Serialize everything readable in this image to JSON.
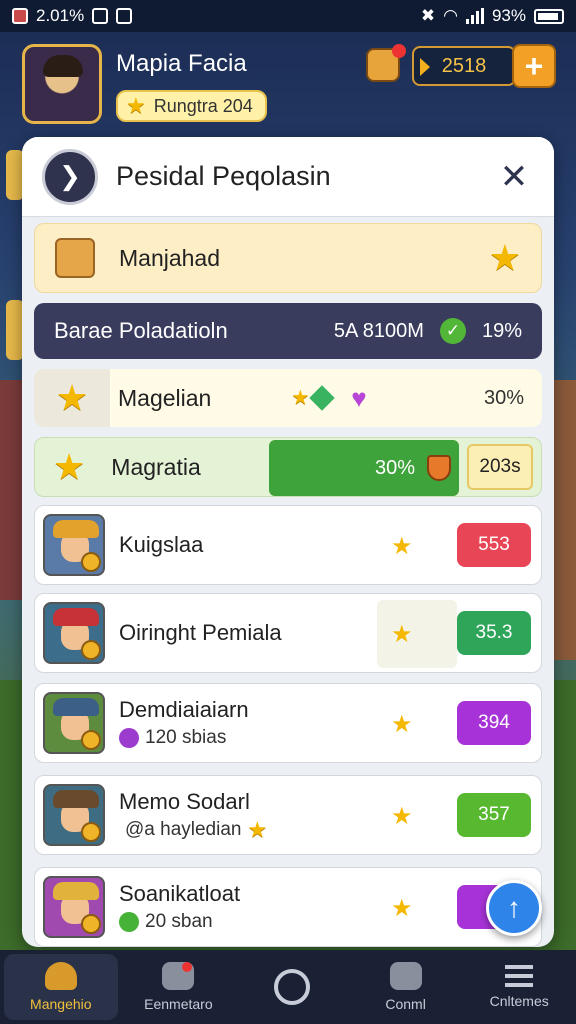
{
  "status_bar": {
    "time": "2.01%",
    "battery": "93%"
  },
  "header": {
    "player_name": "Mapia Facia",
    "rank_label": "Rungtra 204",
    "coins": "2518",
    "plus_label": "+"
  },
  "panel": {
    "title": "Pesidal Peqolasin",
    "logo_glyph": "❯",
    "close_label": "✕",
    "row1": {
      "label": "Manjahad",
      "icon": "chest-icon"
    },
    "row2": {
      "label": "Barae Poladatioln",
      "value": "5A 8100M",
      "percent": "19%"
    },
    "row3": {
      "label": "Magelian",
      "percent": "30%"
    },
    "row4": {
      "label": "Magratia",
      "bar_text": "30%",
      "progress": 0.3,
      "box_value": "203s"
    },
    "cards": [
      {
        "name": "Kuigslaa",
        "sub": "",
        "badge": "553",
        "badge_color": "#e84556",
        "hat_color": "#e3a22c",
        "bg": "#5a7ba8"
      },
      {
        "name": "Oiringht Pemiala",
        "sub": "",
        "badge": "35.3",
        "badge_color": "#2fa55a",
        "hat_color": "#c73236",
        "bg": "#3c6d8a"
      },
      {
        "name": "Demdiaiaiarn",
        "sub": "120 sbias",
        "sub_icon_color": "#9b3ccf",
        "badge": "394",
        "badge_color": "#a733d8",
        "hat_color": "#3b5f86",
        "bg": "#5d8c3f"
      },
      {
        "name": "Memo Sodarl",
        "sub": "@a hayledian",
        "sub_icon_color": "none",
        "badge": "357",
        "badge_color": "#58b930",
        "hat_color": "#6a4a2c",
        "bg": "#3e6c82"
      },
      {
        "name": "Soanikatloat",
        "sub": "20 sban",
        "sub_icon_color": "#46b338",
        "badge": "3",
        "badge_color": "#a733d8",
        "hat_color": "#e2b33a",
        "bg": "#a04ab0"
      }
    ]
  },
  "fab": {
    "label": "↑"
  },
  "nav": [
    {
      "label": "Mangehio",
      "active": true
    },
    {
      "label": "Eenmetaro",
      "active": false
    },
    {
      "label": "",
      "active": false
    },
    {
      "label": "Conml",
      "active": false
    },
    {
      "label": "Cnltemes",
      "active": false
    }
  ]
}
